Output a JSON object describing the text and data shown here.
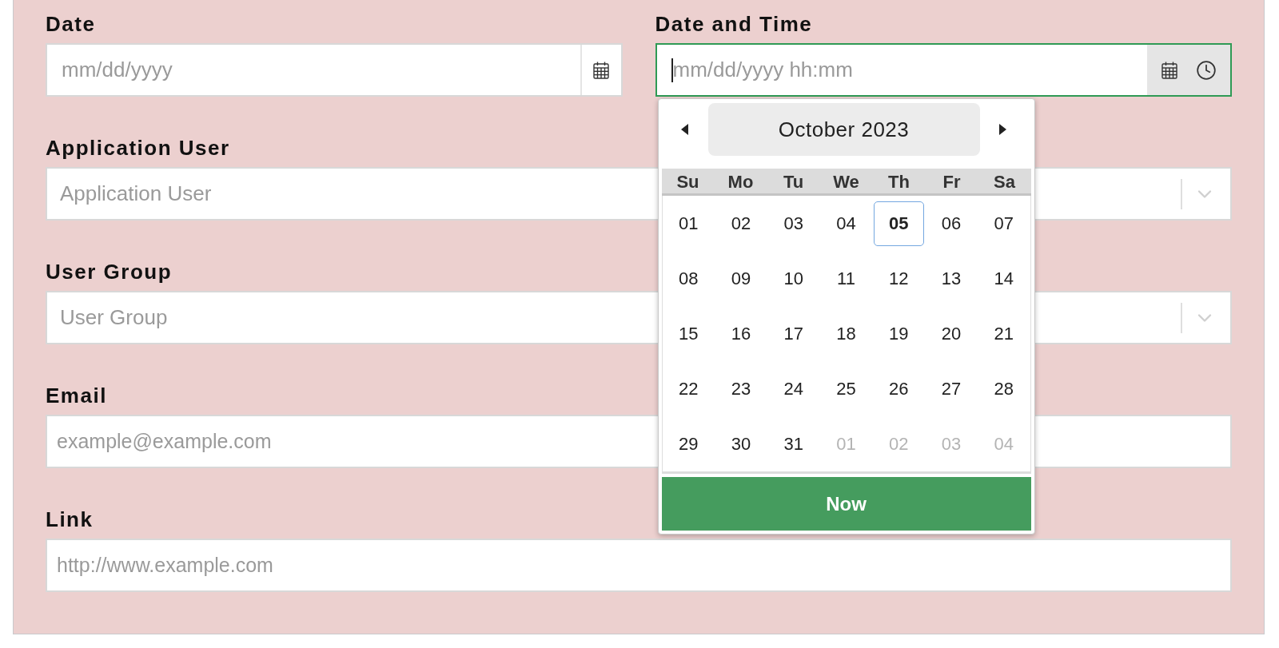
{
  "rows": [
    [
      {
        "kind": "date",
        "label": "Date",
        "placeholder": "mm/dd/yyyy",
        "focused": false
      },
      {
        "kind": "datetime",
        "label": "Date and Time",
        "placeholder": "mm/dd/yyyy hh:mm",
        "focused": true,
        "calendar": {
          "month": "October 2023",
          "weekdays": [
            "Su",
            "Mo",
            "Tu",
            "We",
            "Th",
            "Fr",
            "Sa"
          ],
          "weeks": [
            [
              {
                "text": "01",
                "today": false,
                "other_month": false
              },
              {
                "text": "02",
                "today": false,
                "other_month": false
              },
              {
                "text": "03",
                "today": false,
                "other_month": false
              },
              {
                "text": "04",
                "today": false,
                "other_month": false
              },
              {
                "text": "05",
                "today": true,
                "other_month": false
              },
              {
                "text": "06",
                "today": false,
                "other_month": false
              },
              {
                "text": "07",
                "today": false,
                "other_month": false
              }
            ],
            [
              {
                "text": "08",
                "today": false,
                "other_month": false
              },
              {
                "text": "09",
                "today": false,
                "other_month": false
              },
              {
                "text": "10",
                "today": false,
                "other_month": false
              },
              {
                "text": "11",
                "today": false,
                "other_month": false
              },
              {
                "text": "12",
                "today": false,
                "other_month": false
              },
              {
                "text": "13",
                "today": false,
                "other_month": false
              },
              {
                "text": "14",
                "today": false,
                "other_month": false
              }
            ],
            [
              {
                "text": "15",
                "today": false,
                "other_month": false
              },
              {
                "text": "16",
                "today": false,
                "other_month": false
              },
              {
                "text": "17",
                "today": false,
                "other_month": false
              },
              {
                "text": "18",
                "today": false,
                "other_month": false
              },
              {
                "text": "19",
                "today": false,
                "other_month": false
              },
              {
                "text": "20",
                "today": false,
                "other_month": false
              },
              {
                "text": "21",
                "today": false,
                "other_month": false
              }
            ],
            [
              {
                "text": "22",
                "today": false,
                "other_month": false
              },
              {
                "text": "23",
                "today": false,
                "other_month": false
              },
              {
                "text": "24",
                "today": false,
                "other_month": false
              },
              {
                "text": "25",
                "today": false,
                "other_month": false
              },
              {
                "text": "26",
                "today": false,
                "other_month": false
              },
              {
                "text": "27",
                "today": false,
                "other_month": false
              },
              {
                "text": "28",
                "today": false,
                "other_month": false
              }
            ],
            [
              {
                "text": "29",
                "today": false,
                "other_month": false
              },
              {
                "text": "30",
                "today": false,
                "other_month": false
              },
              {
                "text": "31",
                "today": false,
                "other_month": false
              },
              {
                "text": "01",
                "today": false,
                "other_month": true
              },
              {
                "text": "02",
                "today": false,
                "other_month": true
              },
              {
                "text": "03",
                "today": false,
                "other_month": true
              },
              {
                "text": "04",
                "today": false,
                "other_month": true
              }
            ]
          ],
          "now_button": "Now"
        }
      }
    ],
    [
      {
        "kind": "select",
        "label": "Application User",
        "placeholder": "Application User",
        "focused": false
      }
    ],
    [
      {
        "kind": "select",
        "label": "User Group",
        "placeholder": "User Group",
        "focused": false
      }
    ],
    [
      {
        "kind": "text",
        "label": "Email",
        "placeholder": "example@example.com",
        "focused": false
      }
    ],
    [
      {
        "kind": "text",
        "label": "Link",
        "placeholder": "http://www.example.com",
        "focused": false
      }
    ]
  ]
}
